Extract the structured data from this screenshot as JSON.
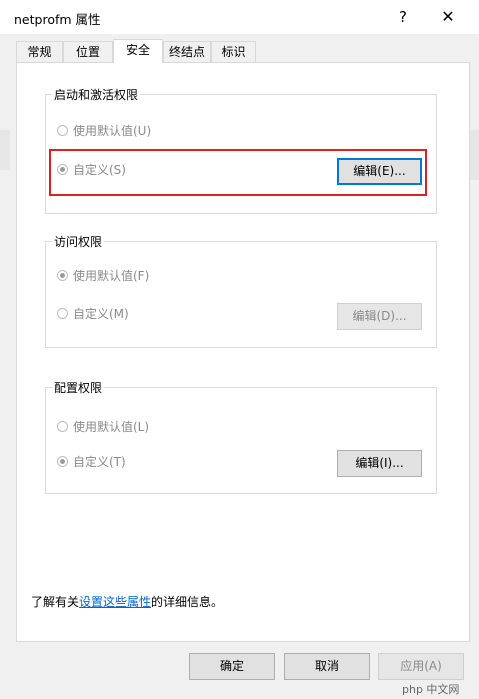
{
  "window": {
    "title": "netprofm 属性",
    "help": "?",
    "close": "✕"
  },
  "tabs": [
    {
      "label": "常规"
    },
    {
      "label": "位置"
    },
    {
      "label": "安全"
    },
    {
      "label": "终结点"
    },
    {
      "label": "标识"
    }
  ],
  "groups": {
    "launch": {
      "label": "启动和激活权限",
      "use_default": "使用默认值(U)",
      "custom": "自定义(S)",
      "edit": "编辑(E)..."
    },
    "access": {
      "label": "访问权限",
      "use_default": "使用默认值(F)",
      "custom": "自定义(M)",
      "edit": "编辑(D)..."
    },
    "config": {
      "label": "配置权限",
      "use_default": "使用默认值(L)",
      "custom": "自定义(T)",
      "edit": "编辑(I)..."
    }
  },
  "footer": {
    "prefix": "了解有关",
    "link": "设置这些属性",
    "suffix": "的详细信息。"
  },
  "buttons": {
    "ok": "确定",
    "cancel": "取消",
    "apply": "应用(A)"
  },
  "watermark": "php 中文网",
  "colors": {
    "highlight": "#e02020",
    "link": "#0066cc",
    "focus_border": "#0078d7"
  }
}
